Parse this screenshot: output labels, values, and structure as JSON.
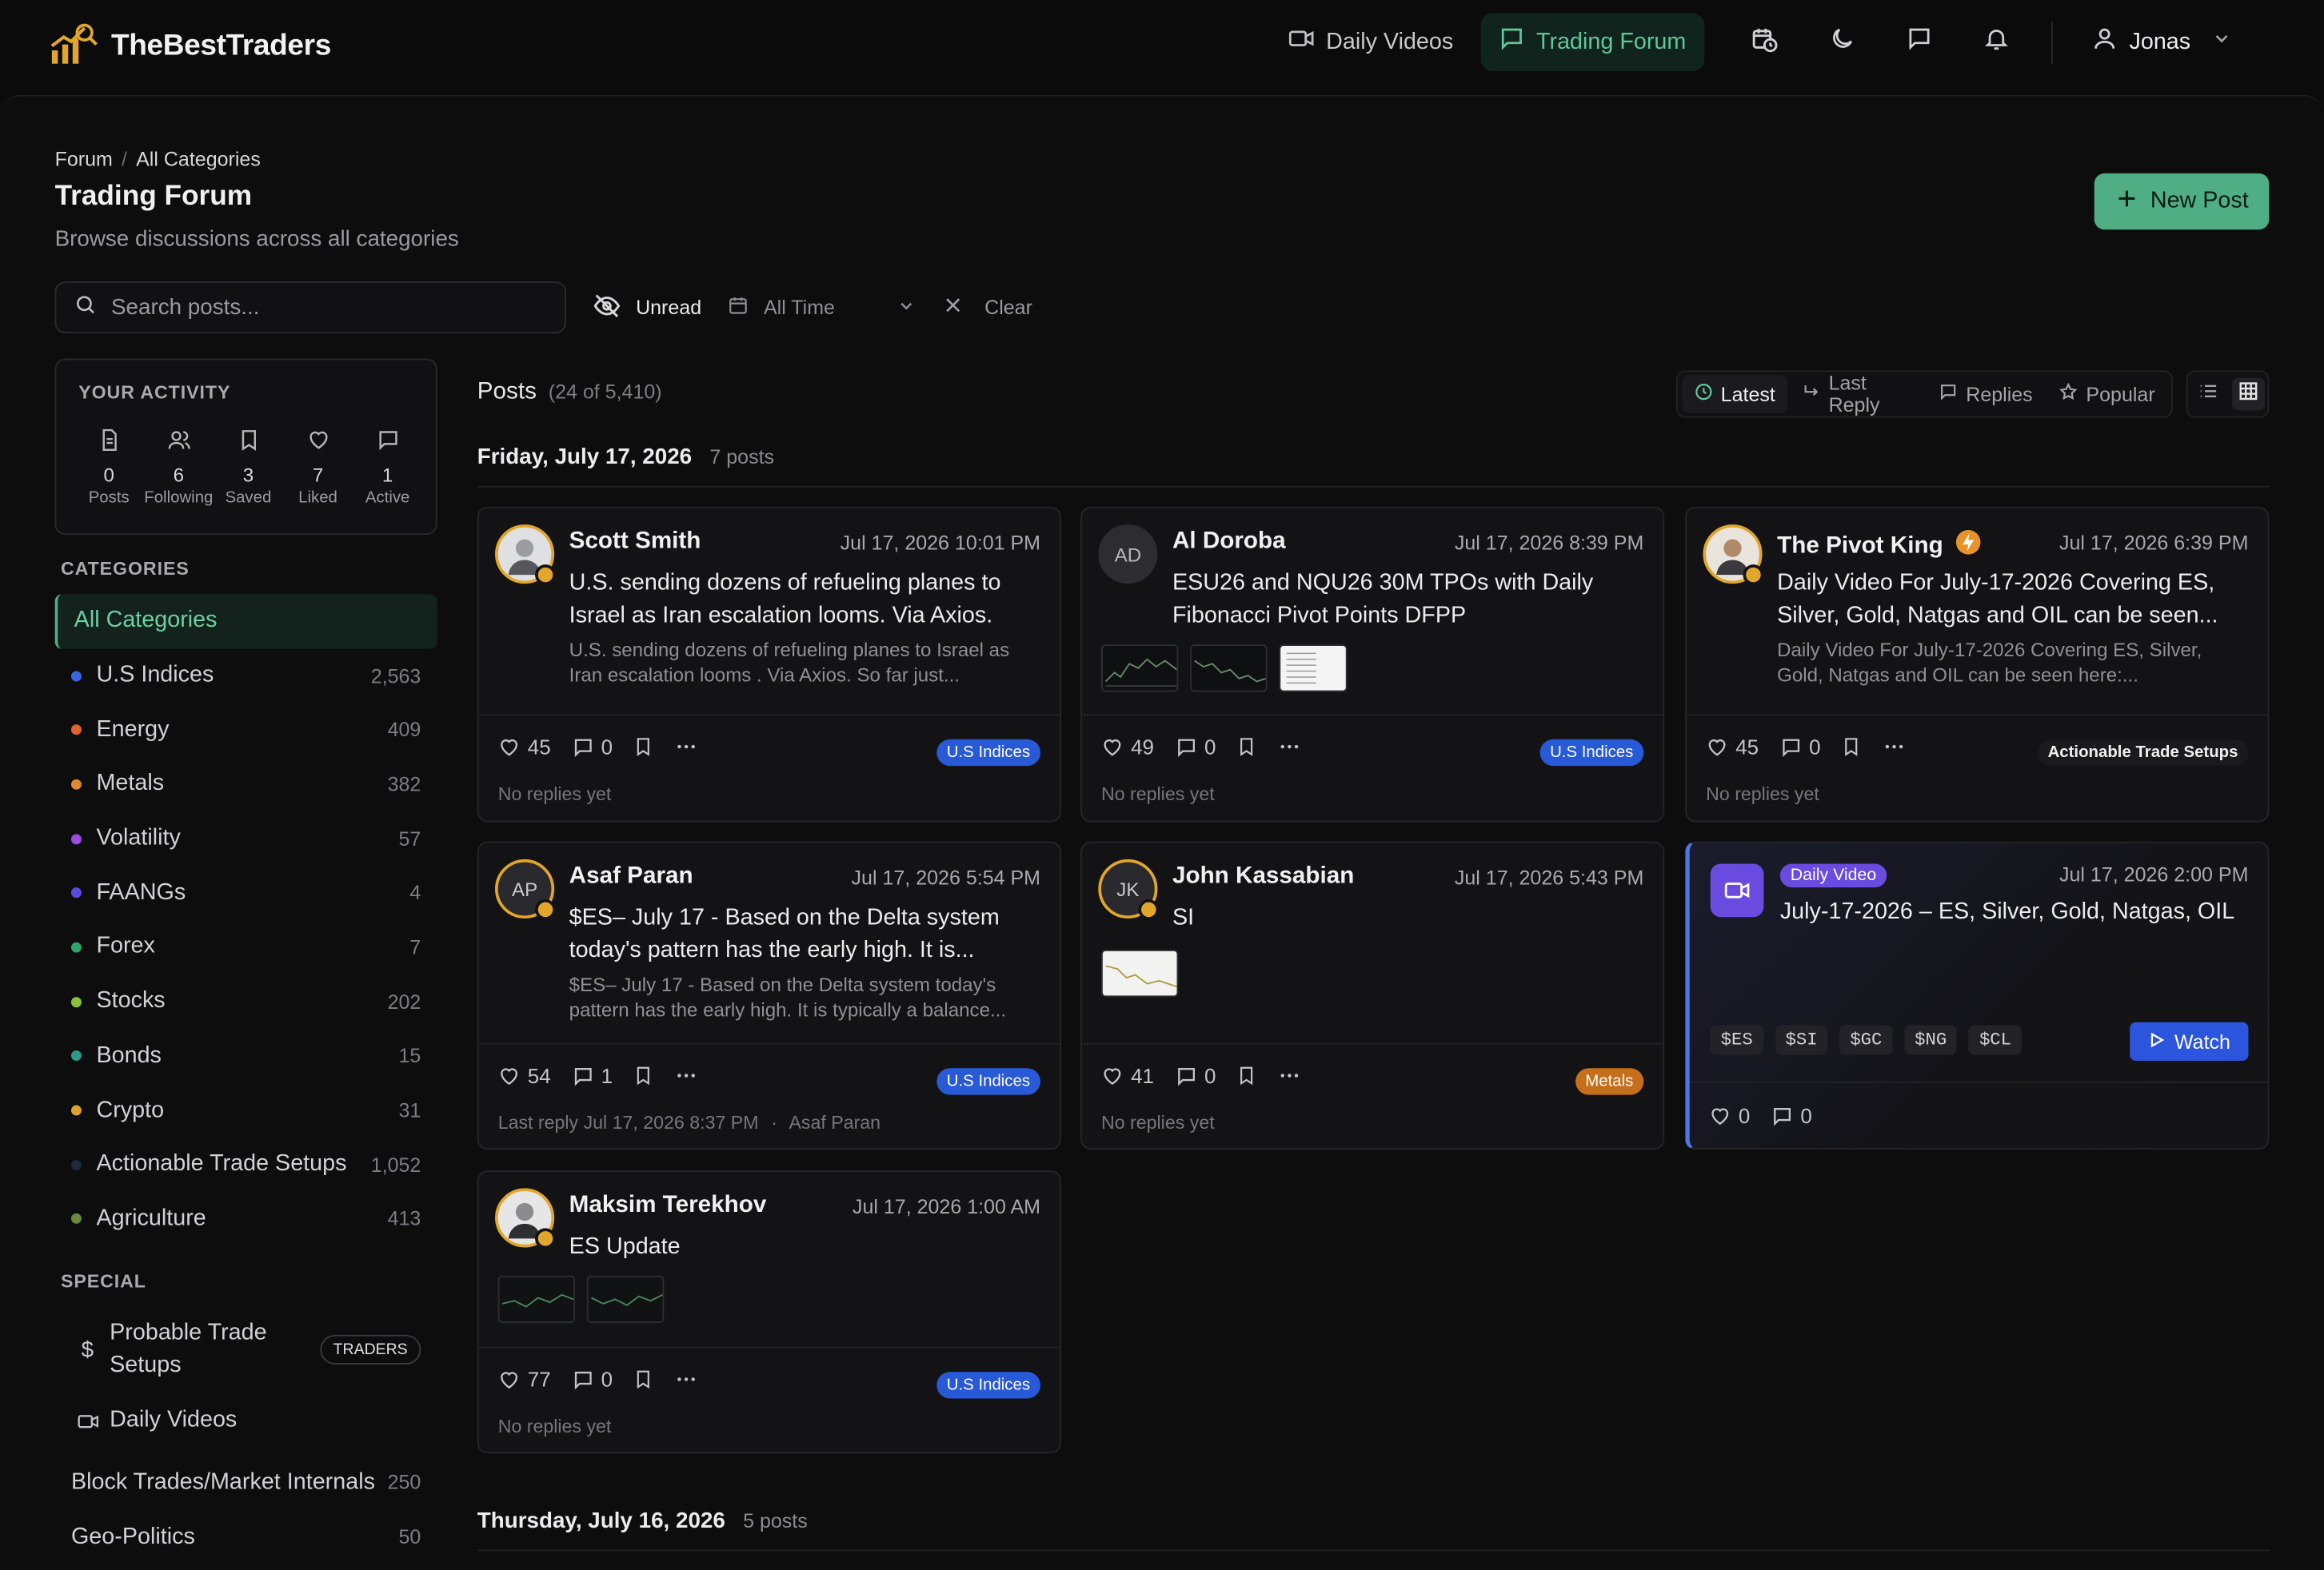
{
  "app": {
    "brand": "TheBestTraders"
  },
  "nav": {
    "daily_videos": "Daily Videos",
    "trading_forum": "Trading Forum",
    "user": "Jonas"
  },
  "breadcrumb": {
    "root": "Forum",
    "current": "All Categories"
  },
  "page": {
    "title": "Trading Forum",
    "subtitle": "Browse discussions across all categories",
    "new_post": "New Post"
  },
  "search": {
    "placeholder": "Search posts..."
  },
  "filters": {
    "unread": "Unread",
    "time": "All Time",
    "clear": "Clear"
  },
  "activity": {
    "title": "YOUR ACTIVITY",
    "stats": [
      {
        "value": "0",
        "label": "Posts"
      },
      {
        "value": "6",
        "label": "Following"
      },
      {
        "value": "3",
        "label": "Saved"
      },
      {
        "value": "7",
        "label": "Liked"
      },
      {
        "value": "1",
        "label": "Active"
      }
    ]
  },
  "categories": {
    "title": "CATEGORIES",
    "items": [
      {
        "label": "All Categories",
        "count": "",
        "color": ""
      },
      {
        "label": "U.S Indices",
        "count": "2,563",
        "color": "#3b64e0"
      },
      {
        "label": "Energy",
        "count": "409",
        "color": "#e0622e"
      },
      {
        "label": "Metals",
        "count": "382",
        "color": "#e08a2e"
      },
      {
        "label": "Volatility",
        "count": "57",
        "color": "#9b4be0"
      },
      {
        "label": "FAANGs",
        "count": "4",
        "color": "#5a4be0"
      },
      {
        "label": "Forex",
        "count": "7",
        "color": "#2ea56a"
      },
      {
        "label": "Stocks",
        "count": "202",
        "color": "#8ac23a"
      },
      {
        "label": "Bonds",
        "count": "15",
        "color": "#2e9a8a"
      },
      {
        "label": "Crypto",
        "count": "31",
        "color": "#e0a02e"
      },
      {
        "label": "Actionable Trade Setups",
        "count": "1,052",
        "color": "#1e2a3a"
      },
      {
        "label": "Agriculture",
        "count": "413",
        "color": "#6a8a3a"
      }
    ]
  },
  "special": {
    "title": "SPECIAL",
    "probable": "Probable Trade Setups",
    "traders_badge": "TRADERS",
    "daily_videos": "Daily Videos",
    "block_trades": "Block Trades/Market Internals",
    "block_count": "250",
    "geo": "Geo-Politics",
    "geo_count": "50"
  },
  "posts": {
    "title": "Posts",
    "count": "(24 of 5,410)",
    "sorts": [
      "Latest",
      "Last Reply",
      "Replies",
      "Popular"
    ]
  },
  "groups": [
    {
      "date": "Friday, July 17, 2026",
      "count": "7 posts"
    },
    {
      "date": "Thursday, July 16, 2026",
      "count": "5 posts"
    }
  ],
  "cards": [
    {
      "author": "Scott Smith",
      "time": "Jul 17, 2026 10:01 PM",
      "title": "U.S. sending dozens of refueling planes to Israel as Iran escalation looms.  Via Axios.",
      "excerpt": "U.S. sending dozens of refueling planes to Israel as Iran escalation looms . Via Axios. So far just...",
      "likes": "45",
      "comments": "0",
      "tag": "U.S Indices",
      "reply": "No replies yet"
    },
    {
      "author": "Al Doroba",
      "initials": "AD",
      "time": "Jul 17, 2026 8:39 PM",
      "title": "ESU26 and NQU26 30M TPOs with Daily Fibonacci Pivot Points DFPP",
      "likes": "49",
      "comments": "0",
      "tag": "U.S Indices",
      "reply": "No replies yet"
    },
    {
      "author": "The Pivot King",
      "time": "Jul 17, 2026 6:39 PM",
      "title": "Daily Video For July-17-2026 Covering ES, Silver, Gold, Natgas and OIL can be seen...",
      "excerpt": "Daily Video For July-17-2026 Covering ES, Silver, Gold, Natgas and OIL can be seen here:...",
      "likes": "45",
      "comments": "0",
      "tag": "Actionable Trade Setups",
      "reply": "No replies yet"
    },
    {
      "author": "Asaf Paran",
      "initials": "AP",
      "time": "Jul 17, 2026 5:54 PM",
      "title": "$ES– July 17  - Based on the Delta system today's pattern has the early high. It is...",
      "excerpt": "$ES– July 17 - Based on the Delta system today's pattern has the early high. It is typically a balance...",
      "likes": "54",
      "comments": "1",
      "tag": "U.S Indices",
      "reply": "Last reply Jul 17, 2026 8:37 PM",
      "reply_by": "Asaf Paran"
    },
    {
      "author": "John Kassabian",
      "initials": "JK",
      "time": "Jul 17, 2026 5:43 PM",
      "title": "SI",
      "likes": "41",
      "comments": "0",
      "tag": "Metals",
      "reply": "No replies yet"
    },
    {
      "author": "Maksim Terekhov",
      "time": "Jul 17, 2026 1:00 AM",
      "title": "ES Update",
      "likes": "77",
      "comments": "0",
      "tag": "U.S Indices",
      "reply": "No replies yet"
    }
  ],
  "video": {
    "badge": "Daily Video",
    "time": "Jul 17, 2026 2:00 PM",
    "title": "July-17-2026 – ES, Silver, Gold, Natgas, OIL",
    "tickers": [
      "$ES",
      "$SI",
      "$GC",
      "$NG",
      "$CL"
    ],
    "watch": "Watch",
    "likes": "0",
    "comments": "0"
  }
}
